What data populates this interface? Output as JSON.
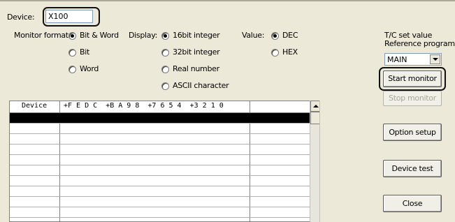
{
  "device": {
    "label": "Device:",
    "value": "X100"
  },
  "monitor_format": {
    "label": "Monitor format:",
    "options": [
      {
        "label": "Bit & Word",
        "selected": true
      },
      {
        "label": "Bit",
        "selected": false
      },
      {
        "label": "Word",
        "selected": false
      }
    ]
  },
  "display": {
    "label": "Display:",
    "options": [
      {
        "label": "16bit integer",
        "selected": true
      },
      {
        "label": "32bit integer",
        "selected": false
      },
      {
        "label": "Real number",
        "selected": false
      },
      {
        "label": "ASCII character",
        "selected": false
      }
    ]
  },
  "value": {
    "label": "Value:",
    "options": [
      {
        "label": "DEC",
        "selected": true
      },
      {
        "label": "HEX",
        "selected": false
      }
    ]
  },
  "tc_ref": {
    "line1": "T/C set value",
    "line2": "Reference program",
    "selected": "MAIN"
  },
  "buttons": {
    "start_monitor": "Start monitor",
    "stop_monitor": "Stop monitor",
    "option_setup": "Option setup",
    "device_test": "Device test",
    "close": "Close"
  },
  "table": {
    "col_device": "Device",
    "col_bits": "+F E D C  +B A 9 8  +7 6 5 4  +3 2 1 0",
    "rows": [
      {
        "device": "",
        "bits": "",
        "value": ""
      },
      {
        "device": "",
        "bits": "",
        "value": ""
      },
      {
        "device": "",
        "bits": "",
        "value": ""
      },
      {
        "device": "",
        "bits": "",
        "value": ""
      },
      {
        "device": "",
        "bits": "",
        "value": ""
      },
      {
        "device": "",
        "bits": "",
        "value": ""
      },
      {
        "device": "",
        "bits": "",
        "value": ""
      },
      {
        "device": "",
        "bits": "",
        "value": ""
      },
      {
        "device": "",
        "bits": "",
        "value": ""
      },
      {
        "device": "",
        "bits": "",
        "value": ""
      }
    ]
  }
}
